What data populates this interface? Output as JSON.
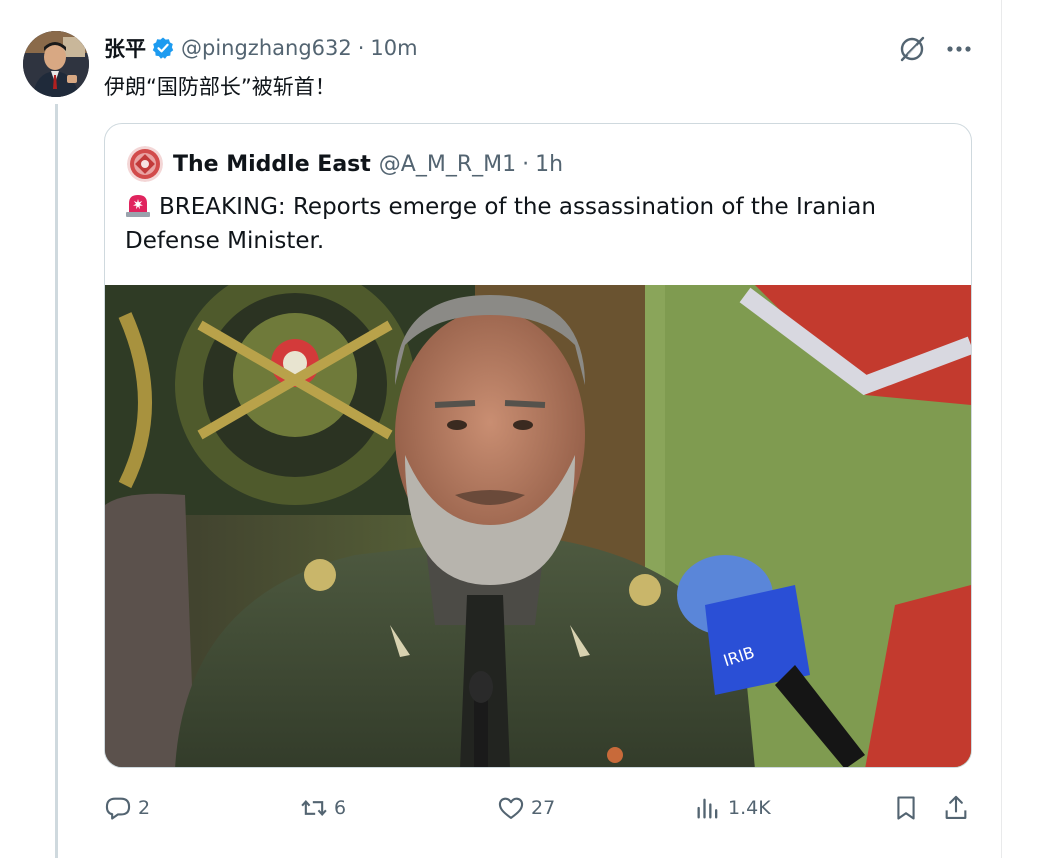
{
  "post": {
    "author": {
      "name": "张平",
      "handle": "@pingzhang632",
      "verified": true,
      "avatar": "avatar"
    },
    "separator": "·",
    "time": "10m",
    "text": "伊朗“国防部长”被斩首！",
    "icons": {
      "grok": "grok-icon",
      "more": "more-icon"
    }
  },
  "quote": {
    "author": {
      "name": "The Middle East",
      "handle": "@A_M_R_M1",
      "avatar": "emblem-avatar"
    },
    "separator": "·",
    "time": "1h",
    "emoji": "siren-icon",
    "text": "BREAKING: Reports emerge of the assassination of the Iranian Defense Minister.",
    "media": {
      "kind": "photo",
      "description": "man in military uniform speaking at a microphone"
    }
  },
  "actions": {
    "reply": {
      "icon": "reply-icon",
      "count": "2"
    },
    "repost": {
      "icon": "repost-icon",
      "count": "6"
    },
    "like": {
      "icon": "like-icon",
      "count": "27"
    },
    "views": {
      "icon": "views-icon",
      "count": "1.4K"
    },
    "bookmark": {
      "icon": "bookmark-icon"
    },
    "share": {
      "icon": "share-icon"
    }
  },
  "colors": {
    "text": "#0f1419",
    "secondary": "#536471",
    "border": "#cfd9de",
    "verified": "#1d9bf0"
  }
}
